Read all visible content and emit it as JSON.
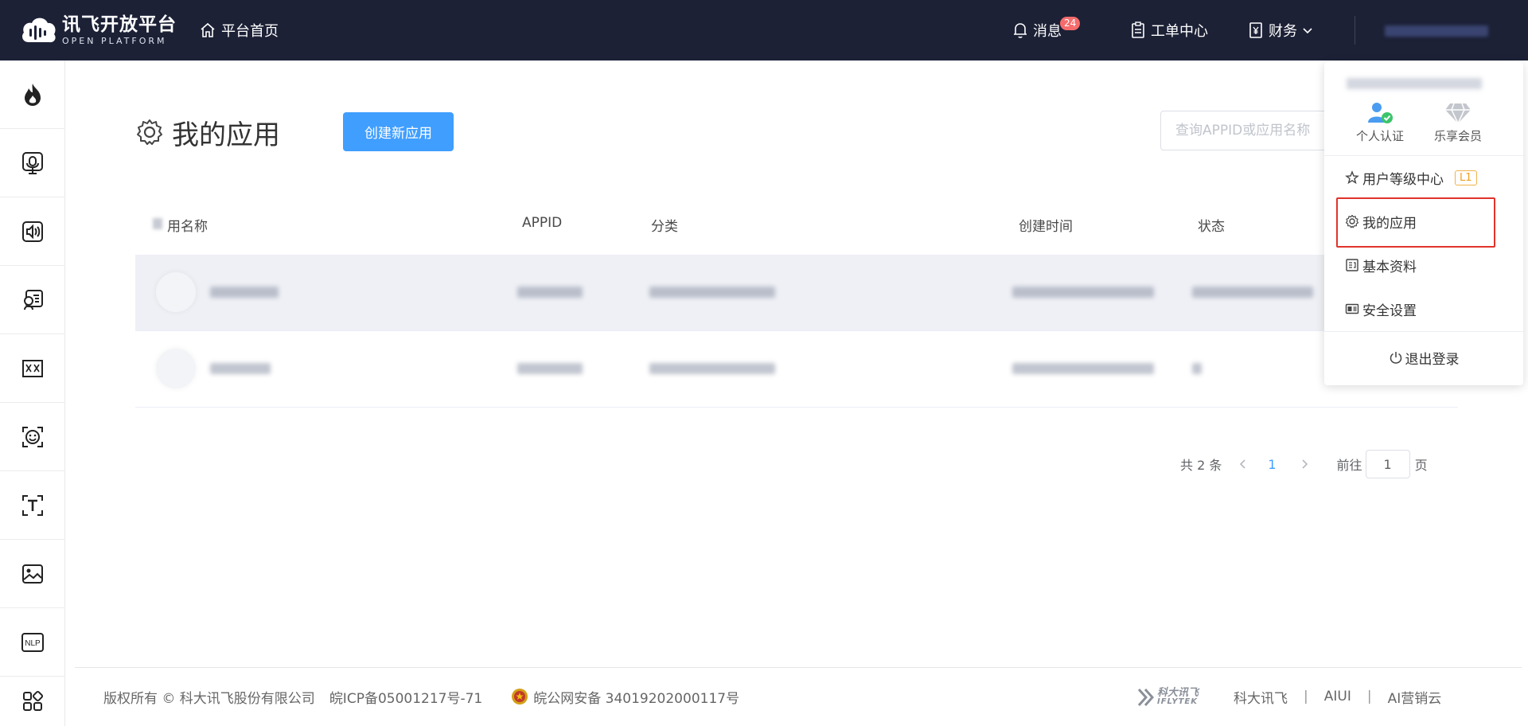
{
  "topbar": {
    "logo_cn": "讯飞开放平台",
    "logo_en": "OPEN PLATFORM",
    "home_label": "平台首页",
    "messages_label": "消息",
    "messages_count": "24",
    "tickets_label": "工单中心",
    "finance_label": "财务"
  },
  "sidebar": {
    "items": [
      {
        "icon": "flame-icon"
      },
      {
        "icon": "voice-recognition-icon"
      },
      {
        "icon": "speech-synthesis-icon"
      },
      {
        "icon": "voice-evaluation-icon"
      },
      {
        "icon": "translation-icon"
      },
      {
        "icon": "face-recognition-icon"
      },
      {
        "icon": "text-recognition-icon"
      },
      {
        "icon": "image-recognition-icon"
      },
      {
        "icon": "nlp-icon",
        "label": "NLP"
      },
      {
        "icon": "more-apps-icon"
      }
    ]
  },
  "main": {
    "title": "我的应用",
    "create_button": "创建新应用",
    "search_placeholder": "查询APPID或应用名称",
    "columns": [
      "用名称",
      "APPID",
      "分类",
      "创建时间",
      "状态"
    ]
  },
  "pagination": {
    "total": "共 2 条",
    "current": "1",
    "goto_label": "前往",
    "goto_value": "1",
    "page_suffix": "页"
  },
  "dropdown": {
    "personal_cert": "个人认证",
    "vip": "乐享会员",
    "level_center": "用户等级中心",
    "level_badge": "L1",
    "my_apps": "我的应用",
    "basic_info": "基本资料",
    "security": "安全设置",
    "logout": "退出登录"
  },
  "footer": {
    "copyright": "版权所有 © 科大讯飞股份有限公司",
    "icp": "皖ICP备05001217号-71",
    "police": "皖公网安备 34019202000117号",
    "brand_cn": "科大讯飞",
    "brand_en": "IFLYTEK",
    "link1": "科大讯飞",
    "link2": "AIUI",
    "link3": "AI营销云",
    "sep": "|"
  },
  "colors": {
    "topbar_bg": "#1c2136",
    "primary": "#409eff",
    "highlight": "#e0332b",
    "badge": "#f56c6c"
  }
}
